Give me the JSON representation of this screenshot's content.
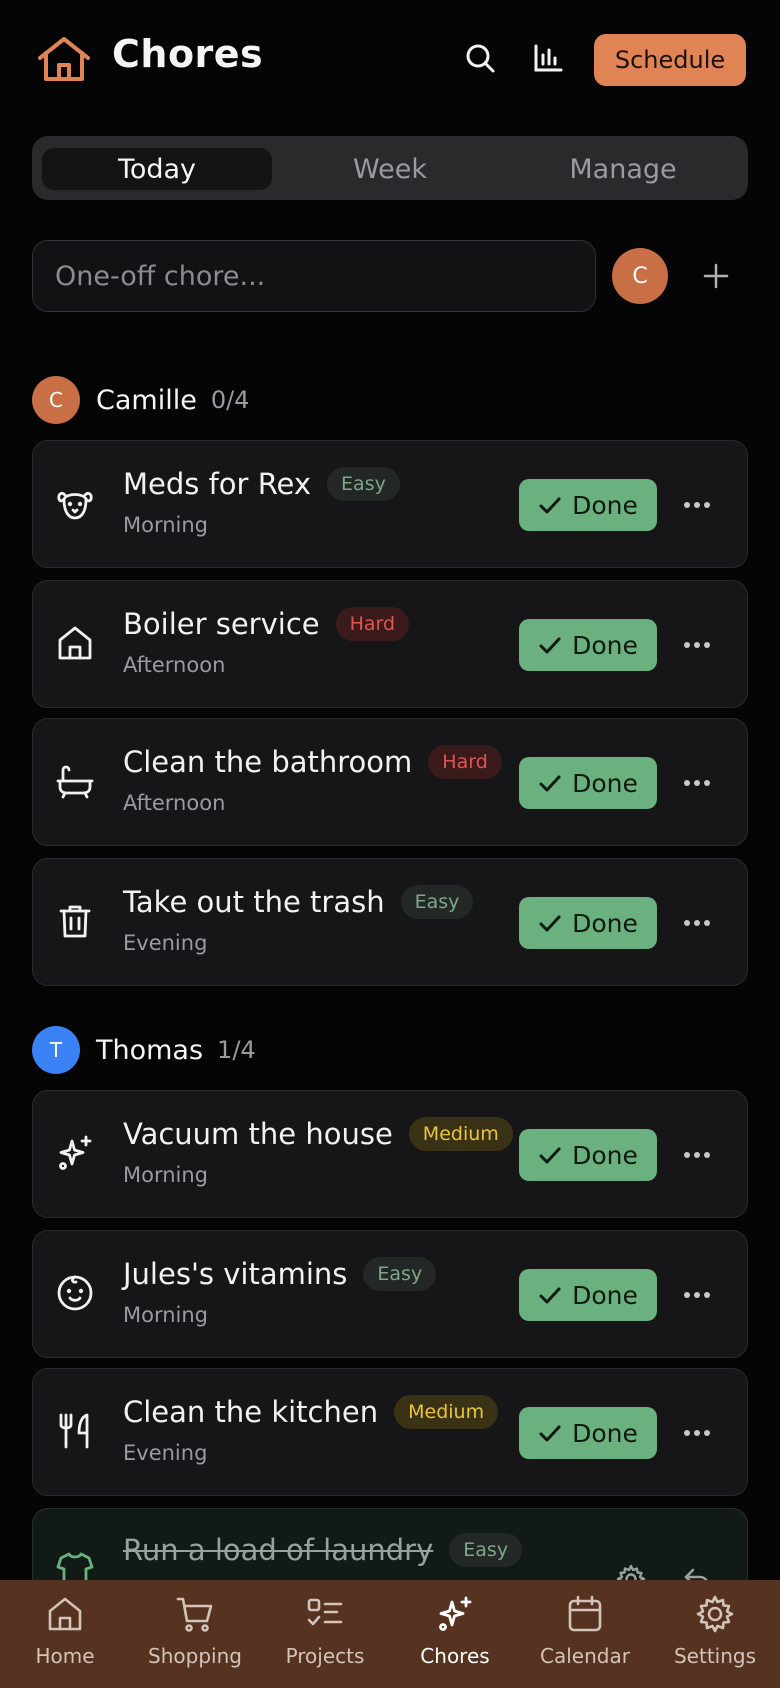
{
  "header": {
    "title": "Chores",
    "logo_icon": "house-icon",
    "search_icon": "search-icon",
    "stats_icon": "bar-chart-icon",
    "schedule_label": "Schedule"
  },
  "tabs": [
    {
      "label": "Today",
      "active": true
    },
    {
      "label": "Week",
      "active": false
    },
    {
      "label": "Manage",
      "active": false
    }
  ],
  "oneoff": {
    "placeholder": "One-off chore...",
    "assignee_initial": "C",
    "add_icon": "plus-icon"
  },
  "sections": [
    {
      "name": "Camille",
      "initial": "C",
      "count": "0/4",
      "color": "#c86f45",
      "chores": [
        {
          "title": "Meds for Rex",
          "difficulty": "Easy",
          "time": "Morning",
          "icon": "dog-icon",
          "action": "Done"
        },
        {
          "title": "Boiler service",
          "difficulty": "Hard",
          "time": "Afternoon",
          "icon": "house-icon",
          "action": "Done"
        },
        {
          "title": "Clean the bathroom",
          "difficulty": "Hard",
          "time": "Afternoon",
          "icon": "bathtub-icon",
          "action": "Done"
        },
        {
          "title": "Take out the trash",
          "difficulty": "Easy",
          "time": "Evening",
          "icon": "trash-icon",
          "action": "Done"
        }
      ]
    },
    {
      "name": "Thomas",
      "initial": "T",
      "count": "1/4",
      "color": "#3b82f6",
      "chores": [
        {
          "title": "Vacuum the house",
          "difficulty": "Medium",
          "time": "Morning",
          "icon": "sparkles-icon",
          "action": "Done"
        },
        {
          "title": "Jules's vitamins",
          "difficulty": "Easy",
          "time": "Morning",
          "icon": "baby-icon",
          "action": "Done"
        },
        {
          "title": "Clean the kitchen",
          "difficulty": "Medium",
          "time": "Evening",
          "icon": "utensils-icon",
          "action": "Done"
        },
        {
          "title": "Run a load of laundry",
          "difficulty": "Easy",
          "time": "",
          "icon": "shirt-icon",
          "completed": true
        }
      ]
    }
  ],
  "nav": [
    {
      "label": "Home",
      "icon": "home-icon",
      "active": false
    },
    {
      "label": "Shopping",
      "icon": "cart-icon",
      "active": false
    },
    {
      "label": "Projects",
      "icon": "checklist-icon",
      "active": false
    },
    {
      "label": "Chores",
      "icon": "sparkles-icon",
      "active": true
    },
    {
      "label": "Calendar",
      "icon": "calendar-icon",
      "active": false
    },
    {
      "label": "Settings",
      "icon": "gear-icon",
      "active": false
    }
  ],
  "colors": {
    "accent": "#e08455",
    "done_green": "#6bb07f",
    "nav_bg": "#563220",
    "easy": "#7fa68a",
    "hard": "#e0564f",
    "medium": "#e8c53a"
  }
}
